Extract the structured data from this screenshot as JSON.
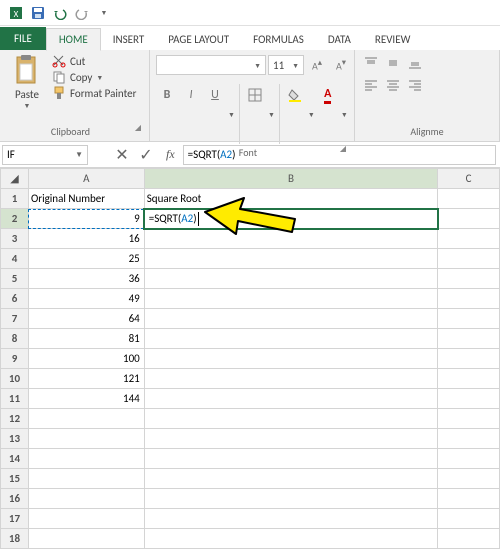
{
  "qat": {
    "save": "save-icon",
    "undo": "undo-icon",
    "redo": "redo-icon"
  },
  "tabs": {
    "file": "FILE",
    "items": [
      "HOME",
      "INSERT",
      "PAGE LAYOUT",
      "FORMULAS",
      "DATA",
      "REVIEW"
    ],
    "active": "HOME"
  },
  "ribbon": {
    "clipboard": {
      "label": "Clipboard",
      "paste": "Paste",
      "cut": "Cut",
      "copy": "Copy",
      "format_painter": "Format Painter"
    },
    "font": {
      "label": "Font",
      "family_placeholder": "",
      "size": "11",
      "bold": "B",
      "italic": "I",
      "underline": "U"
    },
    "alignment": {
      "label": "Alignme"
    }
  },
  "namebox": {
    "value": "IF"
  },
  "formula_bar": {
    "prefix": "=SQRT(",
    "ref": "A2",
    "suffix": ")"
  },
  "columns": [
    "A",
    "B",
    "C"
  ],
  "headers": {
    "A": "Original Number",
    "B": "Square Root"
  },
  "cell_edit": {
    "prefix": "=SQRT(",
    "ref": "A2",
    "suffix": ")"
  },
  "chart_data": {
    "type": "table",
    "columns": [
      "Original Number",
      "Square Root"
    ],
    "rows": [
      {
        "row": 2,
        "Original Number": 9,
        "Square Root": "=SQRT(A2)"
      },
      {
        "row": 3,
        "Original Number": 16,
        "Square Root": ""
      },
      {
        "row": 4,
        "Original Number": 25,
        "Square Root": ""
      },
      {
        "row": 5,
        "Original Number": 36,
        "Square Root": ""
      },
      {
        "row": 6,
        "Original Number": 49,
        "Square Root": ""
      },
      {
        "row": 7,
        "Original Number": 64,
        "Square Root": ""
      },
      {
        "row": 8,
        "Original Number": 81,
        "Square Root": ""
      },
      {
        "row": 9,
        "Original Number": 100,
        "Square Root": ""
      },
      {
        "row": 10,
        "Original Number": 121,
        "Square Root": ""
      },
      {
        "row": 11,
        "Original Number": 144,
        "Square Root": ""
      }
    ]
  },
  "visible_rows": 18,
  "colors": {
    "accent": "#217346",
    "ref": "#0070C0",
    "arrow": "#FFEB00",
    "arrow_stroke": "#000000"
  }
}
